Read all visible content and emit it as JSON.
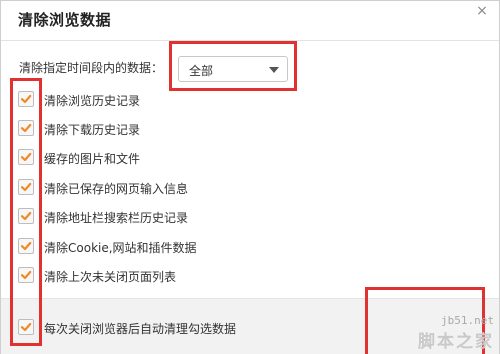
{
  "dialog": {
    "title": "清除浏览数据",
    "close_glyph": "×"
  },
  "range": {
    "label": "清除指定时间段内的数据：",
    "selected": "全部"
  },
  "options": [
    {
      "label": "清除浏览历史记录",
      "checked": true
    },
    {
      "label": "清除下载历史记录",
      "checked": true
    },
    {
      "label": "缓存的图片和文件",
      "checked": true
    },
    {
      "label": "清除已保存的网页输入信息",
      "checked": true
    },
    {
      "label": "清除地址栏搜索栏历史记录",
      "checked": true
    },
    {
      "label": "清除Cookie,网站和插件数据",
      "checked": true
    },
    {
      "label": "清除上次未关闭页面列表",
      "checked": true
    }
  ],
  "footer": {
    "auto_clear_label": "每次关闭浏览器后自动清理勾选数据",
    "auto_clear_checked": true
  },
  "watermark": {
    "url": "jb51.net",
    "name": "脚本之家"
  },
  "colors": {
    "checkmark": "#f08a24",
    "annotation": "#e13232"
  }
}
